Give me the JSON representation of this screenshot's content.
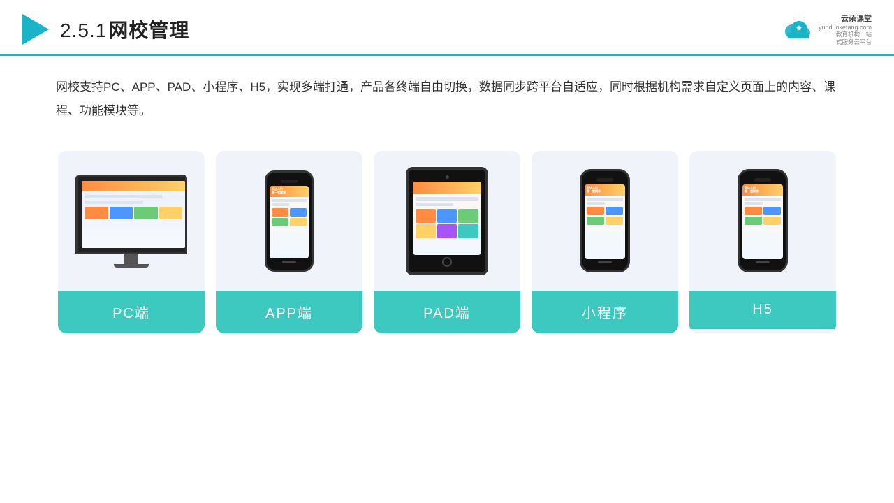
{
  "header": {
    "section_number": "2.5.1",
    "title": "网校管理",
    "brand": {
      "name": "云朵课堂",
      "url": "yunduoketang.com",
      "slogan": "教育机构一站\n式服务云平台"
    }
  },
  "description": {
    "text": "网校支持PC、APP、PAD、小程序、H5，实现多端打通，产品各终端自由切换，数据同步跨平台自适应，同时根据机构需求自定义页面上的内容、课程、功能模块等。"
  },
  "cards": [
    {
      "id": "pc",
      "label": "PC端"
    },
    {
      "id": "app",
      "label": "APP端"
    },
    {
      "id": "pad",
      "label": "PAD端"
    },
    {
      "id": "miniprogram",
      "label": "小程序"
    },
    {
      "id": "h5",
      "label": "H5"
    }
  ],
  "colors": {
    "accent": "#1ab3c8",
    "card_bg": "#f0f4fa",
    "label_bg": "#3dc8c0",
    "label_text": "#ffffff",
    "title_color": "#222222"
  }
}
